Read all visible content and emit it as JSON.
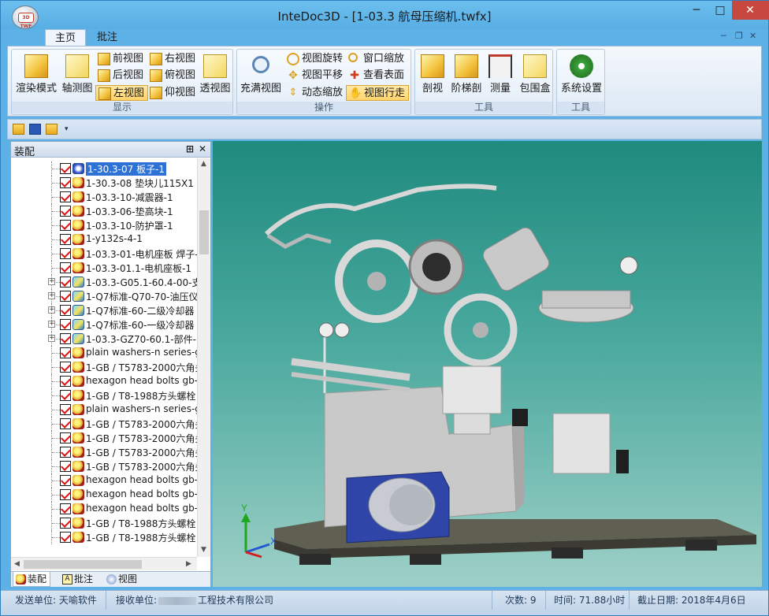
{
  "window": {
    "title": "InteDoc3D - [1-03.3 航母压缩机.twfx]",
    "logo_text": "3D TWF",
    "controls": [
      "─",
      "□",
      "✕"
    ],
    "mdi_controls": [
      "─",
      "❐",
      "✕"
    ]
  },
  "ribbon": {
    "tabs": [
      {
        "label": "主页",
        "active": true
      },
      {
        "label": "批注",
        "active": false
      }
    ],
    "groups": [
      {
        "label": "显示",
        "large_buttons": [
          "渲染模式",
          "轴测图",
          "透视图"
        ],
        "small_buttons": [
          {
            "label": "前视图",
            "selected": false
          },
          {
            "label": "右视图",
            "selected": false
          },
          {
            "label": "后视图",
            "selected": false
          },
          {
            "label": "俯视图",
            "selected": false
          },
          {
            "label": "左视图",
            "selected": true
          },
          {
            "label": "仰视图",
            "selected": false
          }
        ]
      },
      {
        "label": "操作",
        "large_buttons": [
          "充满视图"
        ],
        "small_buttons": [
          {
            "label": "视图旋转",
            "selected": false
          },
          {
            "label": "窗口缩放",
            "selected": false
          },
          {
            "label": "视图平移",
            "selected": false
          },
          {
            "label": "查看表面",
            "selected": false
          },
          {
            "label": "动态缩放",
            "selected": false
          },
          {
            "label": "视图行走",
            "selected": true
          }
        ]
      },
      {
        "label": "工具",
        "large_buttons": [
          "剖视",
          "阶梯剖",
          "测量",
          "包围盒"
        ]
      },
      {
        "label": "工具",
        "large_buttons": [
          "系统设置"
        ]
      }
    ]
  },
  "quick_access": [
    "open-icon",
    "save-icon",
    "export-icon",
    "customize-icon"
  ],
  "assembly_panel": {
    "title": "装配",
    "pin": "⊞",
    "close": "✕",
    "items": [
      {
        "label": "1-30.3-07 板子-1",
        "icon": "link",
        "expandable": false,
        "selected": true
      },
      {
        "label": "1-30.3-08  垫块儿115X1",
        "icon": "gear",
        "expandable": false,
        "selected": false
      },
      {
        "label": "1-03.3-10-减震器-1",
        "icon": "gear",
        "expandable": false,
        "selected": false
      },
      {
        "label": "1-03.3-06-垫高块-1",
        "icon": "gear",
        "expandable": false,
        "selected": false
      },
      {
        "label": "1-03.3-10-防护罩-1",
        "icon": "gear",
        "expandable": false,
        "selected": false
      },
      {
        "label": "1-y132s-4-1",
        "icon": "gear",
        "expandable": false,
        "selected": false
      },
      {
        "label": "1-03.3-01-电机座板 焊子-",
        "icon": "gear",
        "expandable": false,
        "selected": false
      },
      {
        "label": "1-03.3-01.1-电机座板-1",
        "icon": "gear",
        "expandable": false,
        "selected": false
      },
      {
        "label": "1-03.3-G05.1-60.4-00-支",
        "icon": "asm",
        "expandable": true,
        "selected": false
      },
      {
        "label": "1-Q7标准-Q70-70-油压仪",
        "icon": "asm",
        "expandable": true,
        "selected": false
      },
      {
        "label": "1-Q7标准-60-二级冷却器",
        "icon": "asm",
        "expandable": true,
        "selected": false
      },
      {
        "label": "1-Q7标准-60-一级冷却器",
        "icon": "asm",
        "expandable": true,
        "selected": false
      },
      {
        "label": "1-03.3-GZ70-60.1-部件-1",
        "icon": "asm",
        "expandable": true,
        "selected": false
      },
      {
        "label": "plain washers-n series-g",
        "icon": "gear",
        "expandable": false,
        "selected": false
      },
      {
        "label": "1-GB / T5783-2000六角头",
        "icon": "gear",
        "expandable": false,
        "selected": false
      },
      {
        "label": "hexagon head bolts gb-",
        "icon": "gear",
        "expandable": false,
        "selected": false
      },
      {
        "label": "1-GB / T8-1988方头螺栓",
        "icon": "gear",
        "expandable": false,
        "selected": false
      },
      {
        "label": "plain washers-n series-g",
        "icon": "gear",
        "expandable": false,
        "selected": false
      },
      {
        "label": "1-GB / T5783-2000六角头",
        "icon": "gear",
        "expandable": false,
        "selected": false
      },
      {
        "label": "1-GB / T5783-2000六角头",
        "icon": "gear",
        "expandable": false,
        "selected": false
      },
      {
        "label": "1-GB / T5783-2000六角头",
        "icon": "gear",
        "expandable": false,
        "selected": false
      },
      {
        "label": "1-GB / T5783-2000六角头",
        "icon": "gear",
        "expandable": false,
        "selected": false
      },
      {
        "label": "hexagon head bolts gb-",
        "icon": "gear",
        "expandable": false,
        "selected": false
      },
      {
        "label": "hexagon head bolts gb-",
        "icon": "gear",
        "expandable": false,
        "selected": false
      },
      {
        "label": "hexagon head bolts gb-",
        "icon": "gear",
        "expandable": false,
        "selected": false
      },
      {
        "label": "1-GB / T8-1988方头螺栓",
        "icon": "gear",
        "expandable": false,
        "selected": false
      },
      {
        "label": "1-GB / T8-1988方头螺栓",
        "icon": "gear",
        "expandable": false,
        "selected": false
      }
    ],
    "bottom_tabs": [
      {
        "label": "装配",
        "active": true
      },
      {
        "label": "批注",
        "active": false
      },
      {
        "label": "视图",
        "active": false
      }
    ]
  },
  "viewport": {
    "axis_y": "Y",
    "axis_x": "X",
    "background_top": "#1f8a7e",
    "background_bottom": "#9ed0c7"
  },
  "status": {
    "sender": "发送单位: 天喻软件",
    "receiver_prefix": "接收单位:",
    "receiver_suffix": "工程技术有限公司",
    "count": "次数: 9",
    "time": "时间: 71.88小时",
    "deadline": "截止日期: 2018年4月6日"
  }
}
